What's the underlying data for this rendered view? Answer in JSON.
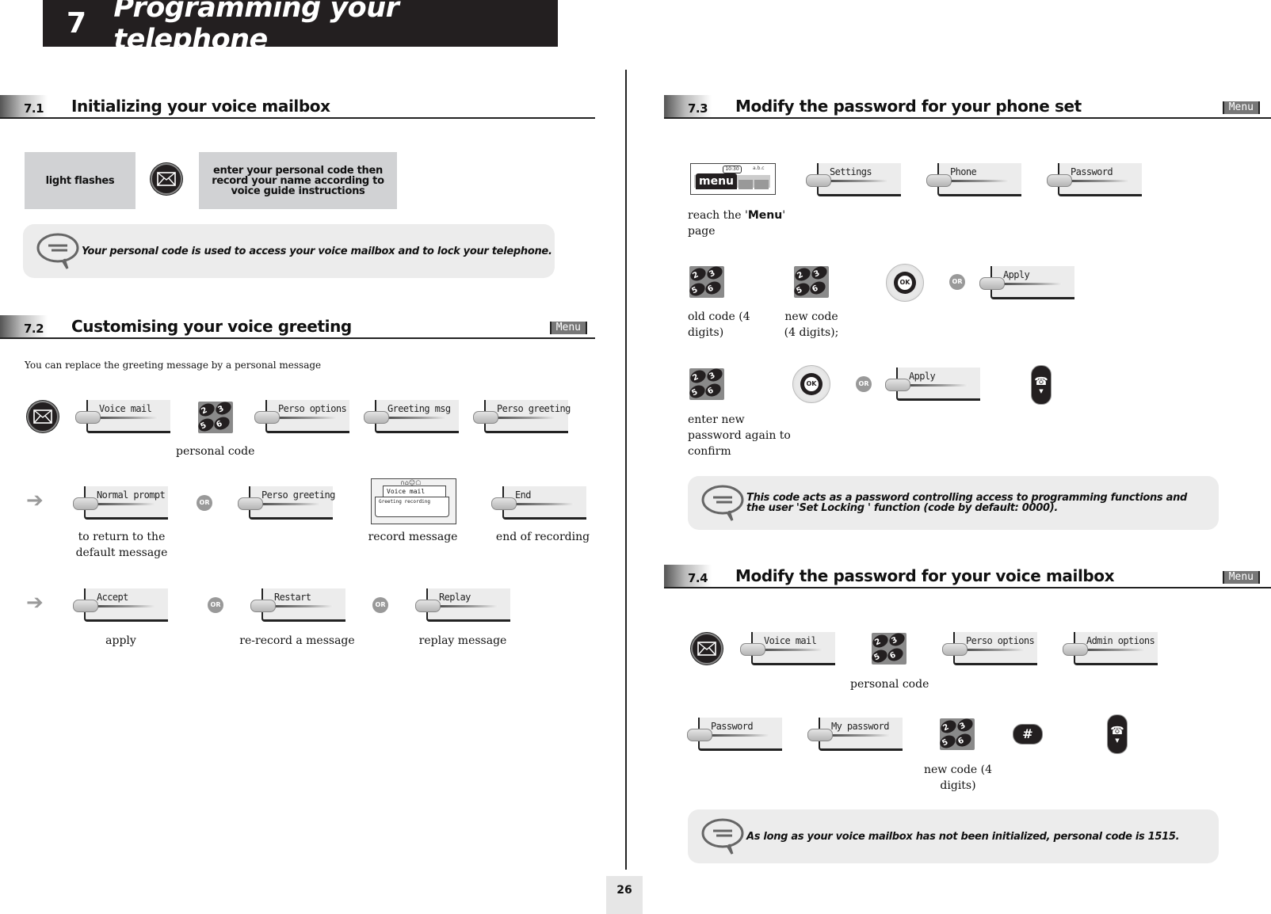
{
  "chapter": {
    "number": "7",
    "title": "Programming your telephone"
  },
  "page_number": "26",
  "menu_badge": "Menu",
  "or_label": "OR",
  "sections": {
    "s71": {
      "number": "7.1",
      "title": "Initializing your voice mailbox",
      "box_left": "light flashes",
      "box_right": "enter your personal code then record your name according to voice guide instructions",
      "note": "Your personal code is used to access your voice mailbox and to lock your telephone."
    },
    "s72": {
      "number": "7.2",
      "title": "Customising your voice greeting",
      "intro": "You can replace the greeting message by a personal message",
      "row1": {
        "keys": [
          "Voice mail",
          "Perso options",
          "Greeting msg",
          "Perso greeting"
        ],
        "keypad_caption": "personal code"
      },
      "row2": {
        "keys": [
          "Normal prompt",
          "Perso greeting",
          "End"
        ],
        "screen": {
          "status_icons": "∩⌂☺☖",
          "tab": "Voice mail",
          "line": "Greeting recording"
        },
        "captions": [
          "to return to the default message",
          "record message",
          "end of recording"
        ]
      },
      "row3": {
        "keys": [
          "Accept",
          "Restart",
          "Replay"
        ],
        "captions": [
          "apply",
          "re-record a message",
          "replay message"
        ]
      }
    },
    "s73": {
      "number": "7.3",
      "title": "Modify the password for your phone set",
      "menu_screen": {
        "time": "10:30",
        "status": "a.b.c",
        "button": "menu"
      },
      "caption_menu_pre": "reach the '",
      "caption_menu_bold": "Menu",
      "caption_menu_post": "' page",
      "row1_keys": [
        "Settings",
        "Phone",
        "Password"
      ],
      "row2": {
        "captions": [
          "old code (4 digits)",
          "new code (4 digits);"
        ],
        "ok_label": "OK",
        "apply_key": "Apply"
      },
      "row3": {
        "caption": "enter new password again to confirm",
        "ok_label": "OK",
        "apply_key": "Apply"
      },
      "note": "This code acts as a password controlling  access to programming functions and the user 'Set  Locking ' function  (code by default: 0000)."
    },
    "s74": {
      "number": "7.4",
      "title": "Modify the password for your voice mailbox",
      "row1_keys": [
        "Voice mail",
        "Perso options",
        "Admin options"
      ],
      "keypad_caption": "personal code",
      "row2_keys": [
        "Password",
        "My password"
      ],
      "row2_caption": "new code (4 digits)",
      "hash_label": "#",
      "note": "As long as your voice mailbox has not been initialized, personal code is 1515."
    }
  },
  "keypad_digits": [
    "2",
    "3",
    "5",
    "6"
  ]
}
